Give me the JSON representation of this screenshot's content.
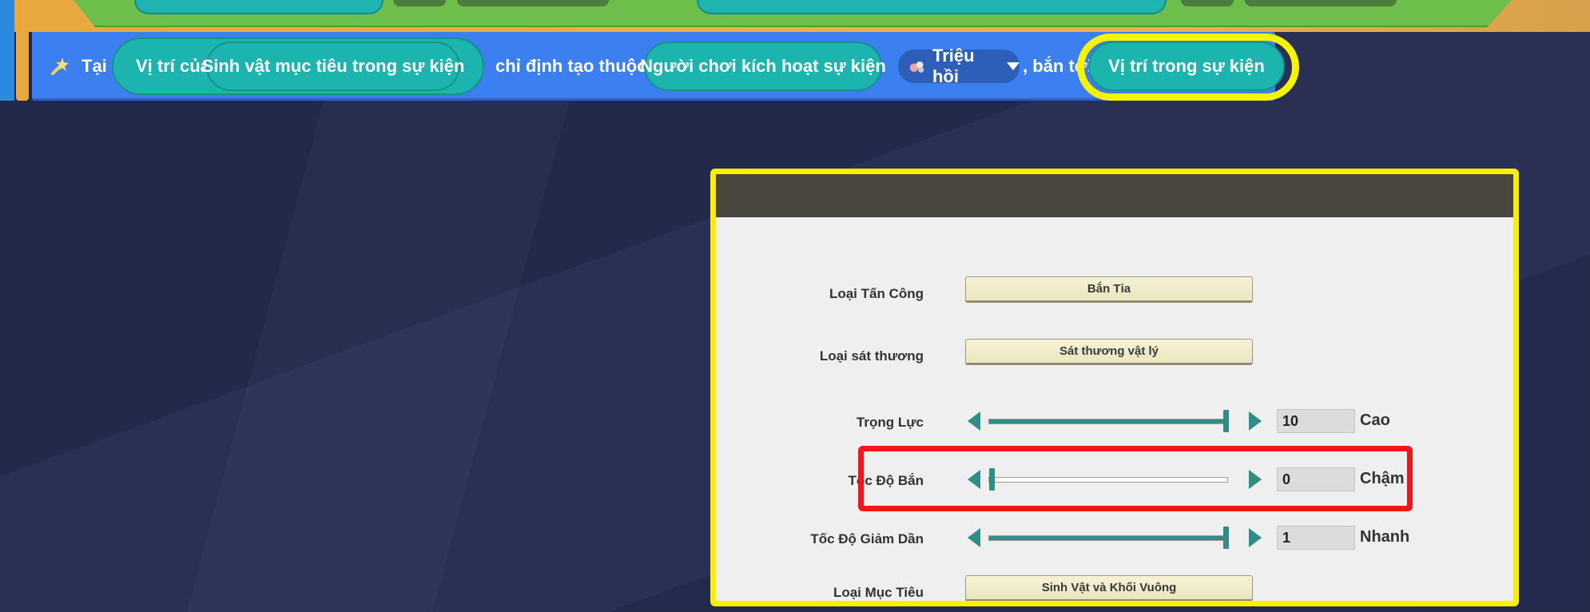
{
  "block": {
    "prefix": "Tại",
    "location_of": "Vị trí của",
    "target": "Sinh vật mục tiêu trong sự kiện",
    "assign_owner": "chỉ định tạo thuộc về",
    "owner": "Người chơi kích hoạt sự kiện",
    "dropdown": "Triệu hồi",
    "shoot_to": ", bắn tới",
    "destination": "Vị trí trong sự kiện"
  },
  "panel": {
    "attack_type": {
      "label": "Loại Tấn Công",
      "value": "Bắn Tỉa"
    },
    "damage_type": {
      "label": "Loại sát thương",
      "value": "Sát thương vật lý"
    },
    "gravity": {
      "label": "Trọng Lực",
      "value": "10",
      "caption": "Cao",
      "level": 1.0
    },
    "shot_speed": {
      "label": "Tốc Độ Bắn",
      "value": "0",
      "caption": "Chậm",
      "level": 0.0
    },
    "decay_speed": {
      "label": "Tốc Độ Giảm Dần",
      "value": "1",
      "caption": "Nhanh",
      "level": 1.0
    },
    "target_type": {
      "label": "Loại Mục Tiêu",
      "value": "Sinh Vật và Khối Vuông"
    }
  },
  "colors": {
    "block_blue": "#3b7ff0",
    "pill_teal": "#1cb5ad",
    "highlight_yellow": "#f8f000",
    "highlight_red": "#f0161c",
    "slider_teal": "#2e8e86"
  },
  "icons": {
    "block": "wand-icon",
    "dropdown": "summon-icon",
    "dropdown_caret": "caret-down-icon"
  }
}
